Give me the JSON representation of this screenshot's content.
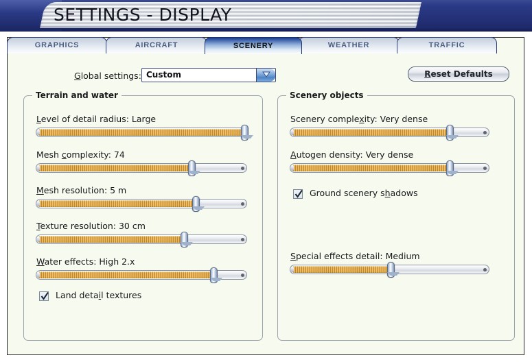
{
  "window": {
    "title": "SETTINGS - DISPLAY"
  },
  "tabs": [
    {
      "label": "GRAPHICS",
      "active": false
    },
    {
      "label": "AIRCRAFT",
      "active": false
    },
    {
      "label": "SCENERY",
      "active": true
    },
    {
      "label": "WEATHER",
      "active": false
    },
    {
      "label": "TRAFFIC",
      "active": false
    }
  ],
  "toolbar": {
    "global_label_accel": "G",
    "global_label_rest": "lobal settings:",
    "global_value": "Custom",
    "global_arrow_icon": "chevron-down-icon",
    "reset_accel": "R",
    "reset_rest": "eset Defaults"
  },
  "terrain_group": {
    "title": "Terrain and water",
    "sliders": [
      {
        "accel": "L",
        "rest": "evel of detail radius: Large",
        "value_text": "Large",
        "percent": 100
      },
      {
        "accel": "c",
        "prefix": "Mesh ",
        "rest": "omplexity: 74",
        "value_text": "74",
        "percent": 74
      },
      {
        "accel": "M",
        "rest": "esh resolution: 5 m",
        "value_text": "5 m",
        "percent": 76
      },
      {
        "accel": "T",
        "rest": "exture resolution: 30 cm",
        "value_text": "30 cm",
        "percent": 70
      },
      {
        "accel": "W",
        "rest": "ater effects: High 2.x",
        "value_text": "High 2.x",
        "percent": 85
      }
    ],
    "checkbox": {
      "prefix": "Land deta",
      "accel": "i",
      "rest": "l textures",
      "checked": true
    }
  },
  "scenery_group": {
    "title": "Scenery objects",
    "sliders": [
      {
        "prefix": "Scenery comple",
        "accel": "x",
        "rest": "ity: Very dense",
        "value_text": "Very dense",
        "percent": 80
      },
      {
        "accel": "A",
        "rest": "utogen density: Very dense",
        "value_text": "Very dense",
        "percent": 80
      },
      {
        "accel": "S",
        "rest": "pecial effects detail: Medium",
        "value_text": "Medium",
        "percent": 50
      }
    ],
    "checkbox": {
      "prefix": "Ground scenery s",
      "accel": "h",
      "rest": "adows",
      "checked": true
    }
  },
  "colors": {
    "titlebar_blue": "#243177",
    "page_background": "#f6faef",
    "slider_fill_gold": "#e0ae50",
    "tab_active_blue": "#1b3a8c",
    "tab_text_inactive": "#4b5f84"
  }
}
